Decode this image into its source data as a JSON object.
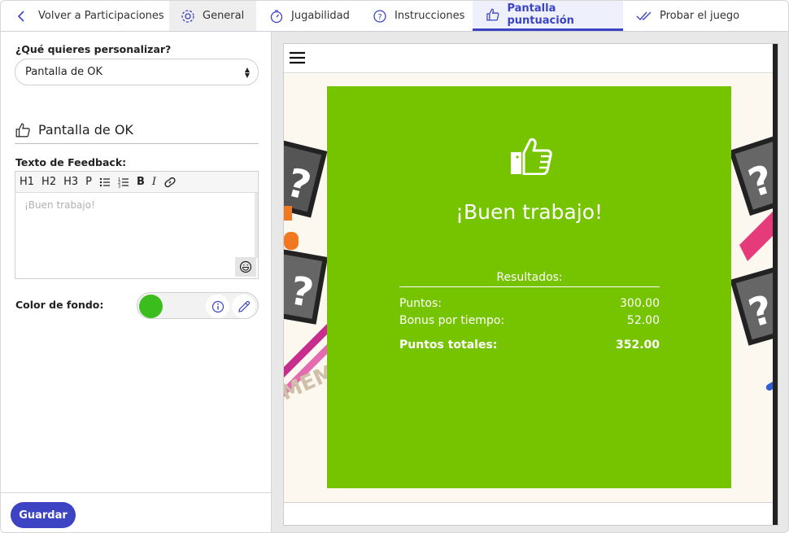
{
  "tabs": {
    "back": "Volver a Participaciones",
    "general": "General",
    "playability": "Jugabilidad",
    "instructions": "Instrucciones",
    "score_screen": "Pantalla puntuación",
    "test_game": "Probar el juego"
  },
  "left": {
    "customize_label": "¿Qué quieres personalizar?",
    "customize_value": "Pantalla de OK",
    "section_title": "Pantalla de OK",
    "feedback_label": "Texto de Feedback:",
    "toolbar": {
      "h1": "H1",
      "h2": "H2",
      "h3": "H3",
      "p": "P",
      "bold": "B",
      "italic": "I"
    },
    "feedback_placeholder": "¡Buen trabajo!",
    "bg_color_label": "Color de fondo:",
    "bg_color": "#3bbd1d",
    "save": "Guardar"
  },
  "preview": {
    "card_color": "#76c400",
    "message": "¡Buen trabajo!",
    "results_title": "Resultados:",
    "rows": [
      {
        "label": "Puntos:",
        "value": "300.00"
      },
      {
        "label": "Bonus por tiempo:",
        "value": "52.00"
      }
    ],
    "total_label": "Puntos totales:",
    "total_value": "352.00",
    "bg_text": "MEMO"
  }
}
